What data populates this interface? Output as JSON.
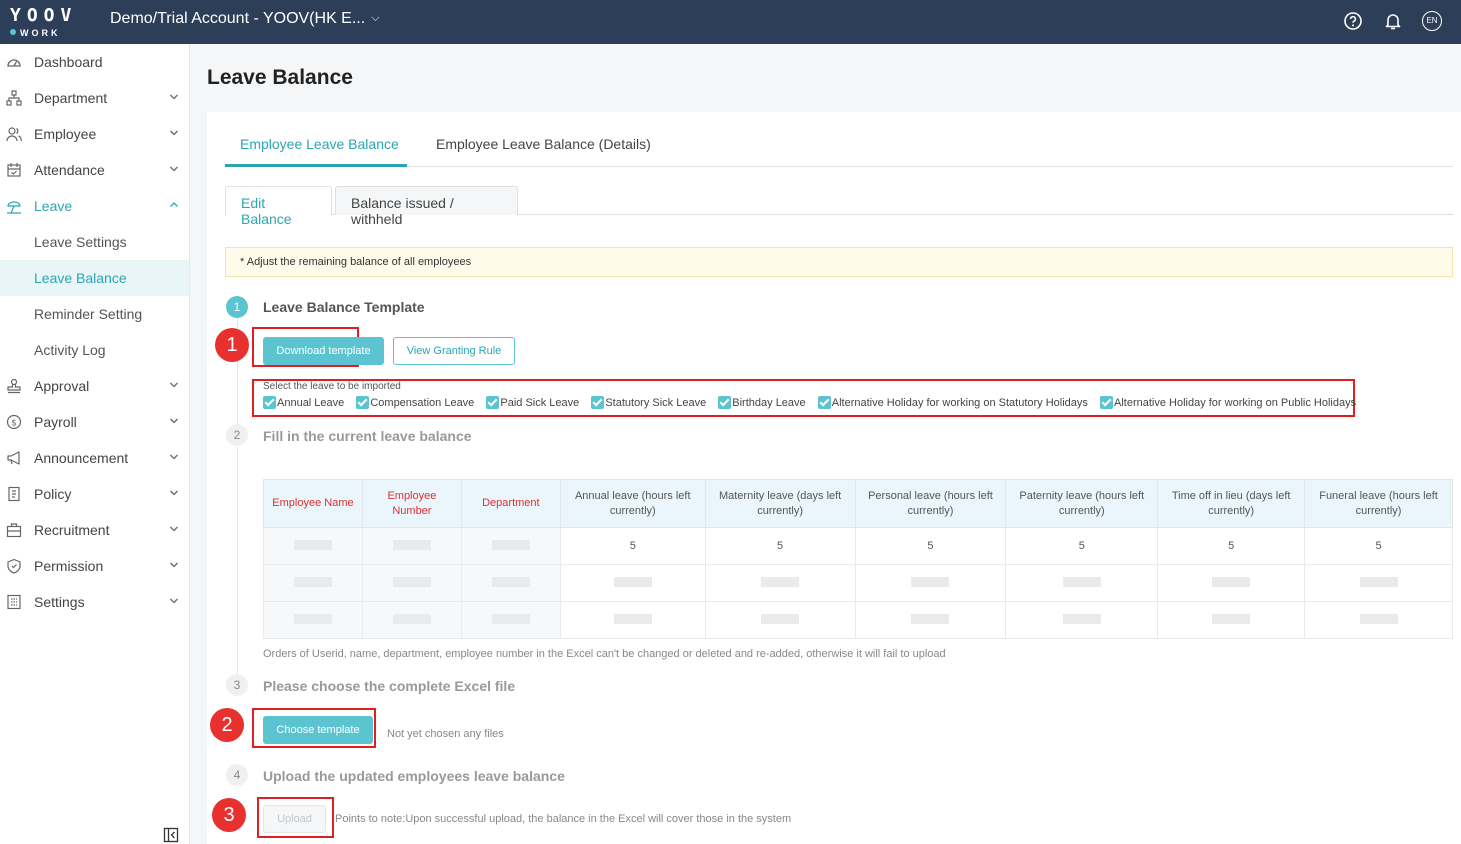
{
  "header": {
    "logo_top": "YOOV",
    "logo_bottom": "WORK",
    "account": "Demo/Trial Account - YOOV(HK E...",
    "lang": "EN"
  },
  "sidebar": {
    "items": [
      {
        "label": "Dashboard",
        "icon": "dashboard-icon"
      },
      {
        "label": "Department",
        "icon": "department-icon"
      },
      {
        "label": "Employee",
        "icon": "employee-icon"
      },
      {
        "label": "Attendance",
        "icon": "attendance-icon"
      },
      {
        "label": "Leave",
        "icon": "leave-icon"
      },
      {
        "label": "Approval",
        "icon": "approval-icon"
      },
      {
        "label": "Payroll",
        "icon": "payroll-icon"
      },
      {
        "label": "Announcement",
        "icon": "announcement-icon"
      },
      {
        "label": "Policy",
        "icon": "policy-icon"
      },
      {
        "label": "Recruitment",
        "icon": "recruitment-icon"
      },
      {
        "label": "Permission",
        "icon": "permission-icon"
      },
      {
        "label": "Settings",
        "icon": "settings-icon"
      }
    ],
    "leave_sub": [
      "Leave Settings",
      "Leave Balance",
      "Reminder Setting",
      "Activity Log"
    ]
  },
  "page": {
    "title": "Leave Balance",
    "tabs": [
      "Employee Leave Balance",
      "Employee Leave Balance (Details)"
    ],
    "subtabs": [
      "Edit Balance",
      "Balance issued / withheld"
    ],
    "notice": "*  Adjust the remaining balance of all employees"
  },
  "steps": {
    "s1": {
      "num": "1",
      "title": "Leave Balance Template"
    },
    "s2": {
      "num": "2",
      "title": "Fill in the current leave balance"
    },
    "s3": {
      "num": "3",
      "title": "Please choose the complete Excel file"
    },
    "s4": {
      "num": "4",
      "title": "Upload the updated employees leave balance"
    }
  },
  "buttons": {
    "download": "Download template",
    "view_rule": "View Granting Rule",
    "choose": "Choose template",
    "upload": "Upload"
  },
  "leave_select": {
    "label": "Select the leave to be imported",
    "options": [
      "Annual Leave",
      "Compensation Leave",
      "Paid Sick Leave",
      "Statutory Sick Leave",
      "Birthday Leave",
      "Alternative Holiday for working on Statutory Holidays",
      "Alternative Holiday for working on Public Holidays"
    ]
  },
  "table": {
    "headers": [
      "Employee Name",
      "Employee Number",
      "Department",
      "Annual leave (hours left currently)",
      "Maternity leave (days left currently)",
      "Personal leave (hours left currently)",
      "Paternity leave (hours left currently)",
      "Time off in lieu (days left currently)",
      "Funeral leave (hours left currently)"
    ],
    "first_row_values": [
      "5",
      "5",
      "5",
      "5",
      "5",
      "5"
    ]
  },
  "note_excel": "Orders of Userid, name, department, employee number in the Excel can't be changed or deleted and re-added, otherwise it will fail to upload",
  "no_file": "Not yet chosen any files",
  "upload_note": "Points to note:Upon successful upload, the balance in the Excel will cover those in the system",
  "annotations": [
    "1",
    "2",
    "3"
  ],
  "colors": {
    "accent": "#5cc4d0",
    "header_bg": "#2c3e58",
    "annotation": "#e02020"
  }
}
